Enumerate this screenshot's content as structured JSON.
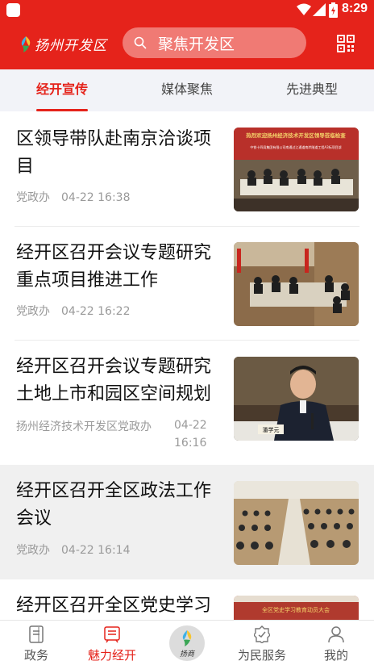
{
  "status_bar": {
    "time": "8:29"
  },
  "header": {
    "logo_text": "扬州开发区",
    "search_text": "聚焦开发区"
  },
  "tabs": [
    {
      "label": "经开宣传",
      "active": true
    },
    {
      "label": "媒体聚焦",
      "active": false
    },
    {
      "label": "先进典型",
      "active": false
    }
  ],
  "news": [
    {
      "title": "区领导带队赴南京洽谈项目",
      "source": "党政办",
      "time": "04-22 16:38"
    },
    {
      "title": "经开区召开会议专题研究重点项目推进工作",
      "source": "党政办",
      "time": "04-22 16:22"
    },
    {
      "title": "经开区召开会议专题研究土地上市和园区空间规划",
      "source": "扬州经济技术开发区党政办",
      "time_date": "04-22",
      "time_clock": "16:16"
    },
    {
      "title": "经开区召开全区政法工作会议",
      "source": "党政办",
      "time": "04-22 16:14"
    },
    {
      "title": "经开区召开全区党史学习"
    }
  ],
  "thumbs": {
    "banner_1": "热烈欢迎扬州经济技术开发区领导莅临检查",
    "banner_1_sub": "中铁十四局集团有限公司南通过江通道南岸隧道工程A3标项目部",
    "nameplate_3": "潘学元",
    "banner_5": "全区党史学习教育动员大会"
  },
  "bottom_nav": [
    {
      "label": "政务",
      "icon": "document-icon",
      "active": false
    },
    {
      "label": "魅力经开",
      "icon": "newspaper-icon",
      "active": true
    },
    {
      "label": "扬商",
      "icon": "yangshang-logo-icon",
      "active": false
    },
    {
      "label": "为民服务",
      "icon": "service-badge-icon",
      "active": false
    },
    {
      "label": "我的",
      "icon": "user-icon",
      "active": false
    }
  ],
  "colors": {
    "brand_red": "#e5231b",
    "tab_bg": "#f2f3f8",
    "meta_gray": "#9a9a9a"
  }
}
